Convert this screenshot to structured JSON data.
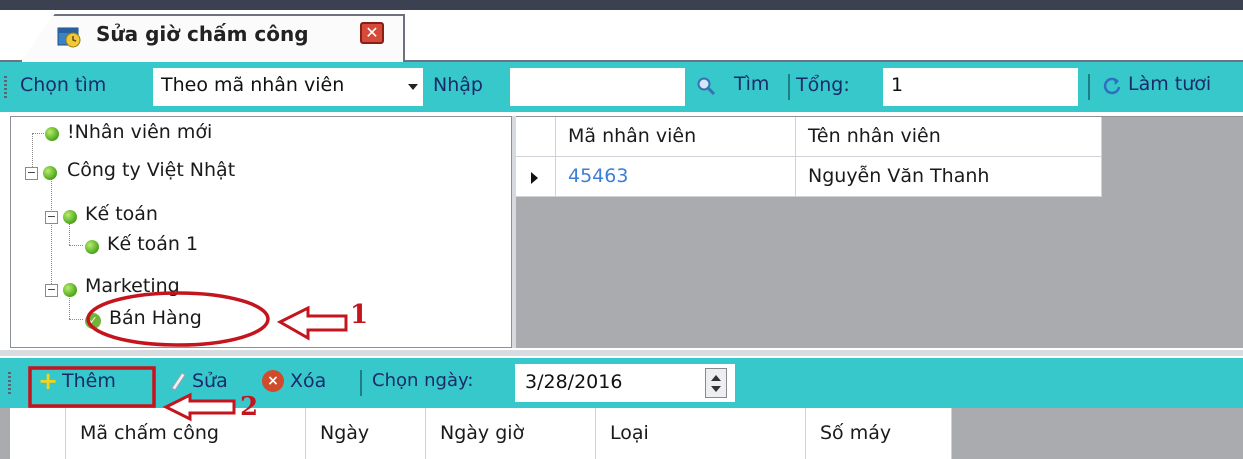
{
  "tab": {
    "title": "Sửa giờ chấm công",
    "close_glyph": "✕",
    "icon": "clock-calendar-icon"
  },
  "search_toolbar": {
    "chon_tim_label": "Chọn tìm",
    "search_mode_value": "Theo mã nhân viên",
    "nhap_label": "Nhập",
    "nhap_value": "",
    "search_button": "Tìm",
    "tong_label": "Tổng:",
    "tong_value": "1",
    "refresh_button": "Làm tươi"
  },
  "tree": {
    "items": [
      {
        "label": "!Nhân viên mới"
      },
      {
        "label": "Công ty Việt Nhật"
      },
      {
        "label": "Kế toán"
      },
      {
        "label": "Kế toán 1"
      },
      {
        "label": "Marketing"
      },
      {
        "label": "Bán Hàng"
      }
    ]
  },
  "employee_grid": {
    "columns": [
      "Mã nhân viên",
      "Tên nhân viên"
    ],
    "rows": [
      {
        "ma": "45463",
        "ten": "Nguyễn Văn Thanh"
      }
    ]
  },
  "bottom_toolbar": {
    "add_button": "Thêm",
    "edit_button": "Sửa",
    "delete_button": "Xóa",
    "chon_ngay_label": "Chọn ngày:",
    "date_value": "3/28/2016"
  },
  "timekeeping_grid": {
    "columns": [
      "Mã chấm công",
      "Ngày",
      "Ngày giờ",
      "Loại",
      "Số máy"
    ]
  },
  "annotations": {
    "step1": "1",
    "step2": "2"
  },
  "colors": {
    "toolbar": "#37c8cc",
    "annotation_red": "#c4141e",
    "link_blue": "#3c7fd8"
  }
}
